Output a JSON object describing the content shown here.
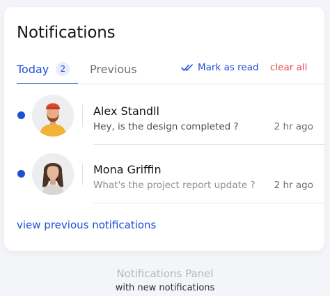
{
  "panel": {
    "title": "Notifications",
    "tabs": [
      {
        "label": "Today",
        "count": "2",
        "active": true
      },
      {
        "label": "Previous",
        "active": false
      }
    ],
    "mark_read_label": "Mark as read",
    "clear_all_label": "clear all",
    "view_previous_label": "view previous notifications"
  },
  "notifications": [
    {
      "name": "Alex Standll",
      "message": "Hey, is the design completed ?",
      "time": "2 hr ago",
      "unread": true,
      "avatar": "person-avatar"
    },
    {
      "name": "Mona Griffin",
      "message": "What's the project report update ?",
      "time": "2 hr ago",
      "unread": true,
      "avatar": "person-avatar"
    }
  ],
  "caption": {
    "title": "Notifications Panel",
    "subtitle": "with new notifications"
  },
  "colors": {
    "accent": "#1d4ed8",
    "unread_dot": "#1f4fd6",
    "danger": "#e5484d",
    "background": "#f4f5f8"
  },
  "icons": {
    "mark_read": "double-check-icon",
    "unread": "unread-dot-icon"
  }
}
